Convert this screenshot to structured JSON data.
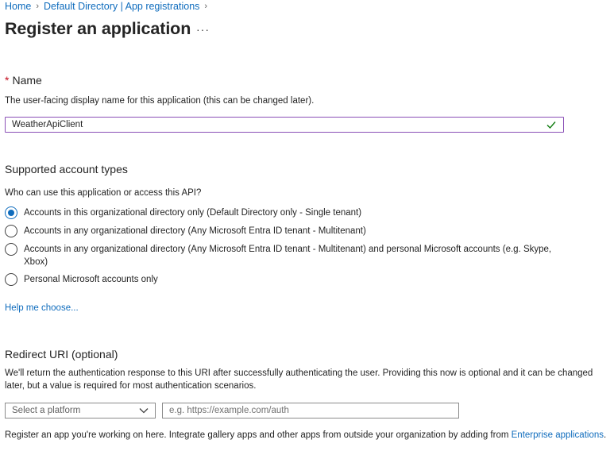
{
  "breadcrumb": {
    "home": "Home",
    "parent": "Default Directory | App registrations"
  },
  "page": {
    "title": "Register an application",
    "more": "···"
  },
  "name_section": {
    "required_marker": "*",
    "label": "Name",
    "help": "The user-facing display name for this application (this can be changed later).",
    "value": "WeatherApiClient"
  },
  "account_types": {
    "heading": "Supported account types",
    "question": "Who can use this application or access this API?",
    "options": [
      {
        "label": "Accounts in this organizational directory only (Default Directory only - Single tenant)",
        "selected": true
      },
      {
        "label": "Accounts in any organizational directory (Any Microsoft Entra ID tenant - Multitenant)",
        "selected": false
      },
      {
        "label": "Accounts in any organizational directory (Any Microsoft Entra ID tenant - Multitenant) and personal Microsoft accounts (e.g. Skype, Xbox)",
        "selected": false
      },
      {
        "label": "Personal Microsoft accounts only",
        "selected": false
      }
    ],
    "help_link": "Help me choose..."
  },
  "redirect": {
    "heading": "Redirect URI (optional)",
    "help": "We'll return the authentication response to this URI after successfully authenticating the user. Providing this now is optional and it can be changed later, but a value is required for most authentication scenarios.",
    "platform_placeholder": "Select a platform",
    "uri_placeholder": "e.g. https://example.com/auth"
  },
  "footer": {
    "text": "Register an app you're working on here. Integrate gallery apps and other apps from outside your organization by adding from ",
    "link": "Enterprise applications",
    "suffix": "."
  },
  "colors": {
    "accent": "#0f6cbd",
    "focus_border": "#8a4fb6",
    "success": "#107c10",
    "required": "#c50f1f"
  }
}
